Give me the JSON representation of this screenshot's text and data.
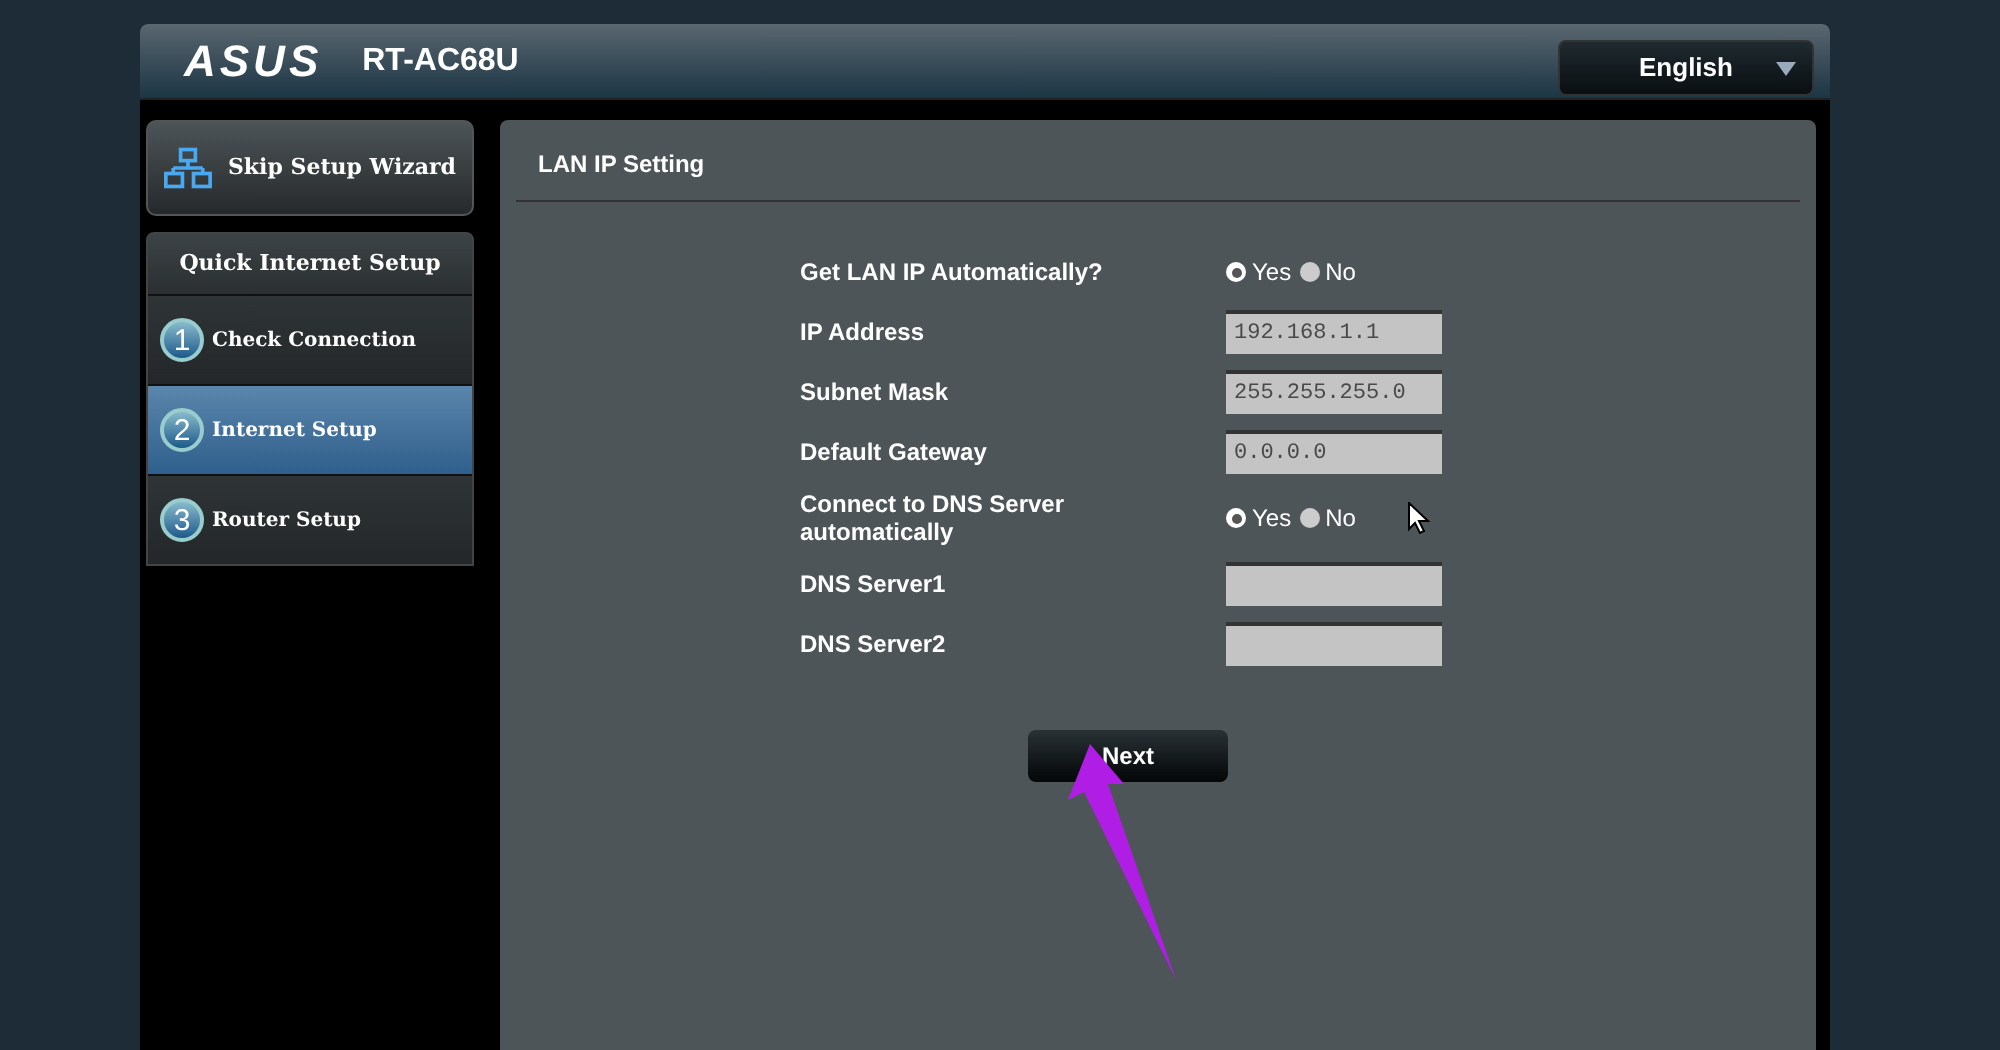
{
  "header": {
    "logo": "ASUS",
    "model": "RT-AC68U",
    "language": "English"
  },
  "sidebar": {
    "skip_button": "Skip Setup Wizard",
    "section_title": "Quick Internet Setup",
    "steps": [
      {
        "number": "1",
        "label": "Check Connection",
        "selected": false
      },
      {
        "number": "2",
        "label": "Internet Setup",
        "selected": true
      },
      {
        "number": "3",
        "label": "Router Setup",
        "selected": false
      }
    ]
  },
  "panel": {
    "title": "LAN IP Setting",
    "rows": [
      {
        "kind": "radio",
        "label": "Get LAN IP Automatically?",
        "options": [
          {
            "label": "Yes",
            "selected": true
          },
          {
            "label": "No",
            "selected": false
          }
        ]
      },
      {
        "kind": "input",
        "label": "IP Address",
        "value": "192.168.1.1"
      },
      {
        "kind": "input",
        "label": "Subnet Mask",
        "value": "255.255.255.0"
      },
      {
        "kind": "input",
        "label": "Default Gateway",
        "value": "0.0.0.0"
      },
      {
        "kind": "radio",
        "label": "Connect to DNS Server automatically",
        "options": [
          {
            "label": "Yes",
            "selected": true
          },
          {
            "label": "No",
            "selected": false
          }
        ]
      },
      {
        "kind": "input",
        "label": "DNS Server1"
      },
      {
        "kind": "input",
        "label": "DNS Server2"
      }
    ],
    "next_button": "Next"
  }
}
